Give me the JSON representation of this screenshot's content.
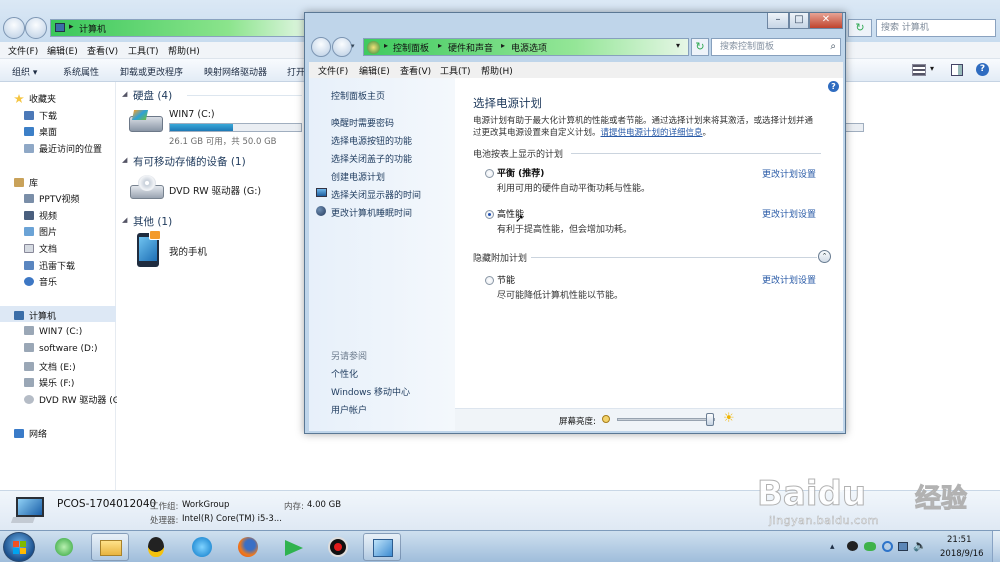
{
  "explorer": {
    "address_crumb": "计算机",
    "search_placeholder": "搜索 计算机",
    "menu": [
      "文件(F)",
      "编辑(E)",
      "查看(V)",
      "工具(T)",
      "帮助(H)"
    ],
    "toolbar": [
      "组织 ▾",
      "系统属性",
      "卸载或更改程序",
      "映射网络驱动器",
      "打开"
    ],
    "nav": {
      "favorites": {
        "label": "收藏夹",
        "items": [
          "下载",
          "桌面",
          "最近访问的位置"
        ]
      },
      "libraries": {
        "label": "库",
        "items": [
          "PPTV视频",
          "视频",
          "图片",
          "文档",
          "迅雷下载",
          "音乐"
        ]
      },
      "computer": {
        "label": "计算机",
        "items": [
          "WIN7 (C:)",
          "software (D:)",
          "文档 (E:)",
          "娱乐 (F:)",
          "DVD RW 驱动器 (G"
        ]
      },
      "network": {
        "label": "网络"
      }
    },
    "groups": {
      "hard_disks": {
        "title": "硬盘 (4)",
        "drive_name": "WIN7 (C:)",
        "drive_free": "26.1 GB 可用，共 50.0 GB",
        "used_fraction": 0.48
      },
      "removable": {
        "title": "有可移动存储的设备 (1)",
        "drive_name": "DVD RW 驱动器 (G:)"
      },
      "other": {
        "title": "其他 (1)",
        "item_name": "我的手机"
      }
    },
    "details": {
      "computer_name": "PCOS-1704012040",
      "workgroup_label": "工作组:",
      "workgroup_value": "WorkGroup",
      "memory_label": "内存:",
      "memory_value": "4.00 GB",
      "cpu_label": "处理器:",
      "cpu_value": "Intel(R) Core(TM) i5-3..."
    }
  },
  "power_window": {
    "breadcrumb": [
      "控制面板",
      "硬件和声音",
      "电源选项"
    ],
    "search_placeholder": "搜索控制面板",
    "menu": [
      "文件(F)",
      "编辑(E)",
      "查看(V)",
      "工具(T)",
      "帮助(H)"
    ],
    "side_links": [
      "控制面板主页",
      "唤醒时需要密码",
      "选择电源按钮的功能",
      "选择关闭盖子的功能",
      "创建电源计划",
      "选择关闭显示器的时间",
      "更改计算机睡眠时间"
    ],
    "see_also_label": "另请参阅",
    "see_also": [
      "个性化",
      "Windows 移动中心",
      "用户帐户"
    ],
    "heading": "选择电源计划",
    "intro_line1": "电源计划有助于最大化计算机的性能或者节能。通过选择计划来将其激活，或选择计划并通",
    "intro_line2": "过更改其电源设置来自定义计划。",
    "intro_link": "请提供电源计划的详细信息",
    "intro_end": "。",
    "battery_section": "电池按表上显示的计划",
    "hidden_section": "隐藏附加计划",
    "plans": [
      {
        "name": "平衡 (推荐)",
        "desc": "利用可用的硬件自动平衡功耗与性能。",
        "link": "更改计划设置",
        "selected": false
      },
      {
        "name": "高性能",
        "desc": "有利于提高性能，但会增加功耗。",
        "link": "更改计划设置",
        "selected": true
      },
      {
        "name": "节能",
        "desc": "尽可能降低计算机性能以节能。",
        "link": "更改计划设置",
        "selected": false
      }
    ],
    "brightness_label": "屏幕亮度:",
    "brightness_level": 1.0
  },
  "taskbar": {
    "time": "21:51",
    "date": "2018/9/16"
  },
  "watermark": {
    "brand": "Baidu",
    "brand_cn": "经验",
    "url": "jingyan.baidu.com"
  },
  "colors": {
    "accent": "#2a5ba7",
    "address_green": "#3fca5f",
    "heading_blue": "#1e395b"
  }
}
